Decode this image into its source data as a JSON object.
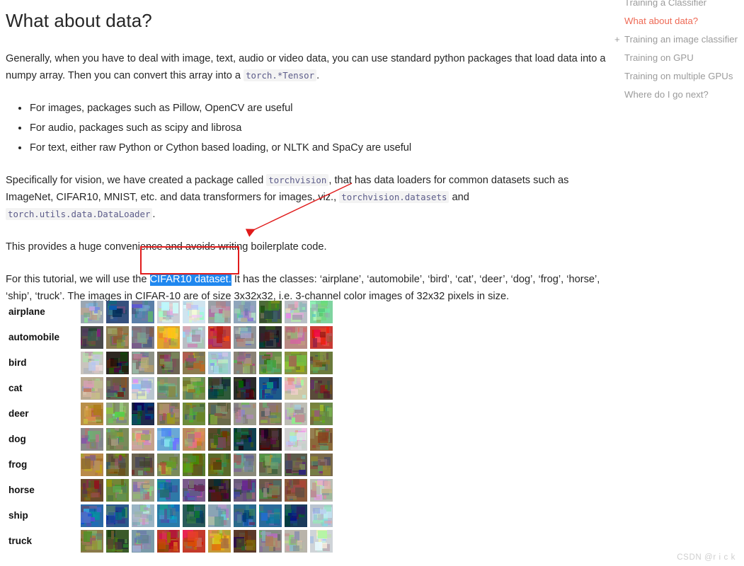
{
  "page": {
    "title": "What about data?",
    "watermark": "CSDN @r i c k"
  },
  "paragraphs": {
    "intro_a": "Generally, when you have to deal with image, text, audio or video data, you can use standard python packages that load data into a numpy array. Then you can convert this array into a ",
    "intro_code": "torch.*Tensor",
    "intro_b": ".",
    "vision_a": "Specifically for vision, we have created a package called ",
    "vision_code1": "torchvision",
    "vision_b": ", that has data loaders for common datasets such as ImageNet, CIFAR10, MNIST, etc. and data transformers for images, viz., ",
    "vision_code2": "torchvision.datasets",
    "vision_c": " and ",
    "vision_code3": "torch.utils.data.DataLoader",
    "vision_d": ".",
    "convenience": "This provides a huge convenience and avoids writing boilerplate code.",
    "tutorial_a": "For this tutorial, we will use the ",
    "tutorial_selected": "CIFAR10 dataset.",
    "tutorial_b": " It has the classes: ‘airplane’, ‘automobile’, ‘bird’, ‘cat’, ‘deer’, ‘dog’, ‘frog’, ‘horse’, ‘ship’, ‘truck’. The images in CIFAR-10 are of size 3x32x32, i.e. 3-channel color images of 32x32 pixels in size."
  },
  "bullets": [
    "For images, packages such as Pillow, OpenCV are useful",
    "For audio, packages such as scipy and librosa",
    "For text, either raw Python or Cython based loading, or NLTK and SpaCy are useful"
  ],
  "toc": {
    "items": [
      {
        "label": "Training a Classifier",
        "active": false,
        "expander": "",
        "cut": true
      },
      {
        "label": "What about data?",
        "active": true,
        "expander": "",
        "cut": false
      },
      {
        "label": "Training an image classifier",
        "active": false,
        "expander": "+",
        "cut": false
      },
      {
        "label": "Training on GPU",
        "active": false,
        "expander": "",
        "cut": false
      },
      {
        "label": "Training on multiple GPUs",
        "active": false,
        "expander": "",
        "cut": false
      },
      {
        "label": "Where do I go next?",
        "active": false,
        "expander": "",
        "cut": false
      }
    ]
  },
  "cifar": {
    "columns": 10,
    "classes": [
      "airplane",
      "automobile",
      "bird",
      "cat",
      "deer",
      "dog",
      "frog",
      "horse",
      "ship",
      "truck"
    ],
    "thumbnail_px": "32x32",
    "thumb_palettes": [
      [
        "#9aa6b2",
        "#35507e",
        "#5b7fa8",
        "#c9ced6",
        "#cfe4ef",
        "#9aa0a6",
        "#8fa5bb",
        "#4b6b3a",
        "#b9bfc6",
        "#7fd4a0"
      ],
      [
        "#4a4a4a",
        "#8a7a52",
        "#7c7c84",
        "#e0a52a",
        "#b9bec4",
        "#c0413a",
        "#8f9499",
        "#2b2b2b",
        "#b98a84",
        "#c93a33"
      ],
      [
        "#c9c4bd",
        "#2e2722",
        "#8d9186",
        "#6d6352",
        "#8b7b4d",
        "#a8c4d6",
        "#8a8276",
        "#6a8d4a",
        "#87903f",
        "#6b7a3c"
      ],
      [
        "#b9a991",
        "#6a5c50",
        "#b9c6cf",
        "#7e8f6a",
        "#7b8b4e",
        "#2f5a3a",
        "#2a2a2a",
        "#1d5a8a",
        "#cfc9a8",
        "#5a4a3a"
      ],
      [
        "#b98f4a",
        "#8ba06a",
        "#1f2b4a",
        "#8a7a52",
        "#6d8a3a",
        "#6a6a4a",
        "#9a9a8a",
        "#8a7a6a",
        "#bdbdb4",
        "#6d8a4a"
      ],
      [
        "#8a8a8a",
        "#7a8a5a",
        "#c4a08a",
        "#6aa8d6",
        "#b98a5a",
        "#5a4a2a",
        "#10404e",
        "#2a1f1a",
        "#cfcfcf",
        "#8a6a3a"
      ],
      [
        "#b98a4a",
        "#6a6a3a",
        "#6a6250",
        "#7a8a5a",
        "#5a7a2a",
        "#5a6a2a",
        "#8a8a7a",
        "#6a7a5a",
        "#5a5a4a",
        "#7a6a4a"
      ],
      [
        "#6a4a2a",
        "#6a8a3a",
        "#9aa08a",
        "#2f79a8",
        "#7a5a8a",
        "#2a2a22",
        "#6a5a7a",
        "#6a5a4a",
        "#8a5a3a",
        "#b9bdb4"
      ],
      [
        "#2a6aa8",
        "#2a5a8a",
        "#9ab4c4",
        "#2a7aa8",
        "#2a5a5a",
        "#8aa4b4",
        "#2a6a8a",
        "#2a6a9a",
        "#1a3a5a",
        "#b9c4cf"
      ],
      [
        "#8a7a4a",
        "#3a5a2a",
        "#7a9aa8",
        "#b93a2a",
        "#c43a2a",
        "#c49a3a",
        "#5a3a2a",
        "#8a8a8a",
        "#b9b4aa",
        "#cfd4d8"
      ]
    ]
  },
  "annotations": {
    "red_box_color": "#e01b1b",
    "arrow_color": "#e01b1b",
    "selection_color": "#1f87ef",
    "active_link_color": "#ee6a56"
  }
}
